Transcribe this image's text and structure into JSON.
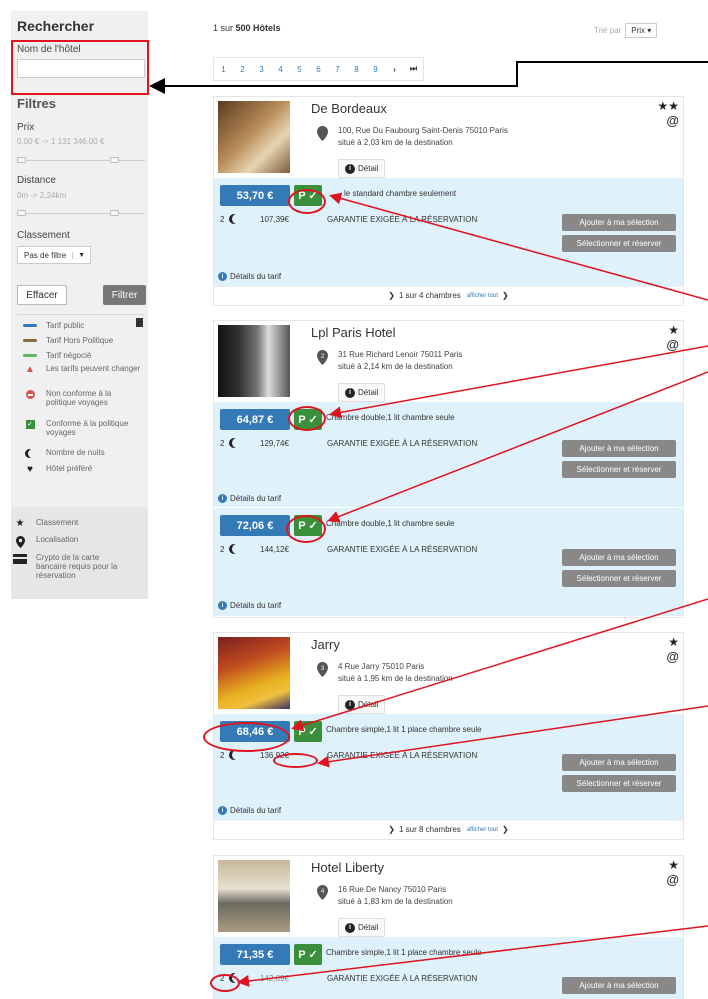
{
  "sidebar": {
    "title": "Rechercher",
    "hotel_name_label": "Nom de l'hôtel",
    "hotel_name_value": "",
    "filters_title": "Filtres",
    "price_label": "Prix",
    "price_range": "0,00 € -> 1 131 346,00 €",
    "distance_label": "Distance",
    "distance_range": "0m -> 2,24km",
    "rating_label": "Classement",
    "rating_select": "Pas de filtre",
    "clear_button": "Effacer",
    "filter_button": "Filtrer"
  },
  "legend": [
    {
      "icon": "blue-bar",
      "color": "#337ab7",
      "label": "Tarif public"
    },
    {
      "icon": "brown-bar",
      "color": "#8a6d3b",
      "label": "Tarif Hors Politique"
    },
    {
      "icon": "green-bar",
      "color": "#5cb85c",
      "label": "Tarif négocié"
    },
    {
      "icon": "warning-triangle-icon",
      "color": "#d9534f",
      "label": "Les tarifs peuvent changer"
    },
    {
      "icon": "no-entry-icon",
      "color": "#d9534f",
      "label": "Non conforme à la politique voyages"
    },
    {
      "icon": "checkbox-icon",
      "color": "#3a8f3a",
      "label": "Conforme à la politique voyages"
    },
    {
      "icon": "moon-icon",
      "label": "Nombre de nuits"
    },
    {
      "icon": "heart-icon",
      "label": "Hôtel préféré"
    },
    {
      "icon": "star-icon",
      "label": "Classement"
    },
    {
      "icon": "location-pin-icon",
      "label": "Localisation"
    },
    {
      "icon": "credit-card-icon",
      "label": "Crypto de la carte bancaire requis pour la réservation"
    }
  ],
  "results": {
    "count_prefix": "1 sur",
    "count_value": "500 Hôtels",
    "sort_label": "Trié par",
    "sort_value": "Prix",
    "pages": [
      "1",
      "2",
      "3",
      "4",
      "5",
      "6",
      "7",
      "8",
      "9"
    ],
    "next_symbol": "›",
    "last_symbol": "⏭"
  },
  "common": {
    "detail_button": "Détail",
    "guarantee": "GARANTIE EXIGÉE À LA RÉSERVATION",
    "add_button": "Ajouter à ma sélection",
    "select_button": "Sélectionner et réserver",
    "tariff_details": "Détails du tarif",
    "show_all": "afficher tout",
    "p_badge": "P ✓"
  },
  "hotels": [
    {
      "name": "De Bordeaux",
      "stars": "★★",
      "address": "100, Rue Du Faubourg Saint-Denis 75010 Paris",
      "distance": "situé à 2,03 km de la destination",
      "price": "53,70 €",
      "room": "le standard chambre seulement",
      "nights": "2",
      "total": "107,39€",
      "rooms_count": "1 sur 4 chambres"
    },
    {
      "name": "Lpl Paris Hotel",
      "stars": "★",
      "pin_number": "2",
      "address": "31 Rue Richard Lenoir 75011 Paris",
      "distance": "situé à 2,14 km de la destination",
      "price": "64,87 €",
      "room": "Chambre double,1 lit chambre seule",
      "nights": "2",
      "total": "129,74€",
      "rate2_price": "72,06 €",
      "rate2_room": "Chambre double,1 lit chambre seule",
      "rate2_nights": "2",
      "rate2_total": "144,12€"
    },
    {
      "name": "Jarry",
      "stars": "★",
      "pin_number": "3",
      "address": "4 Rue Jarry 75010 Paris",
      "distance": "situé à 1,95 km de la destination",
      "price": "68,46 €",
      "room": "Chambre simple,1 lit 1 place chambre seule",
      "nights": "2",
      "total": "136,92€",
      "rooms_count": "1 sur 8 chambres"
    },
    {
      "name": "Hotel Liberty",
      "stars": "★",
      "pin_number": "4",
      "address": "16 Rue De Nancy 75010 Paris",
      "distance": "situé à 1,83 km de la destination",
      "price": "71,35 €",
      "room": "Chambre simple,1 lit 1 place chambre seule",
      "nights": "2",
      "total": "142,69€"
    }
  ]
}
